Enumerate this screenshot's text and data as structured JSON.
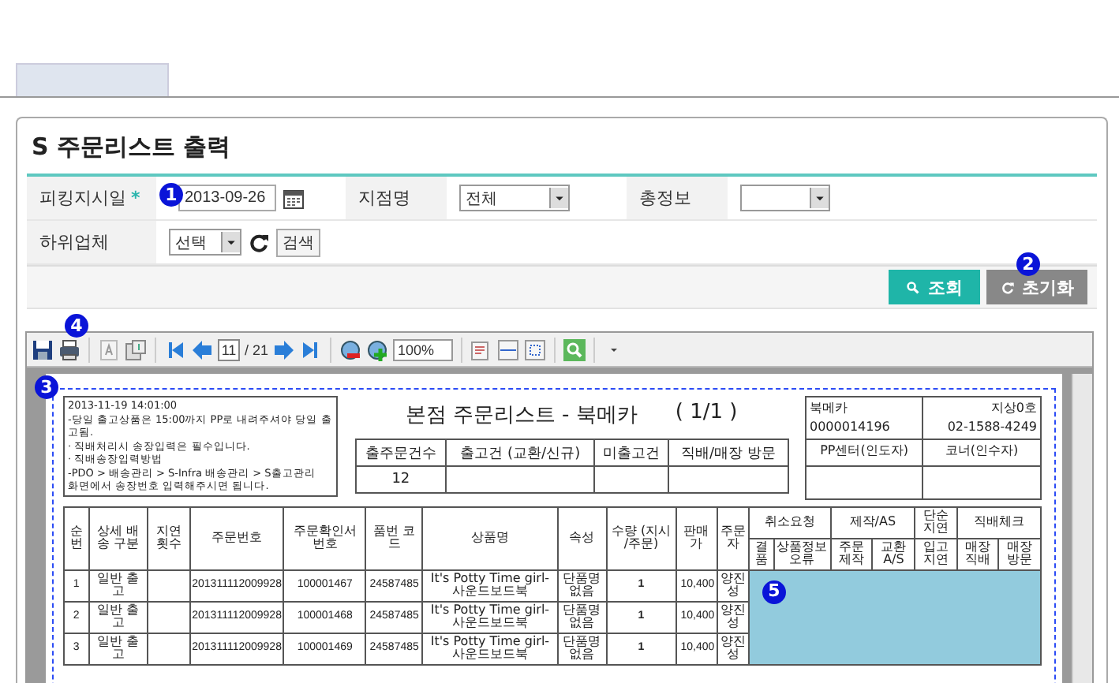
{
  "page": {
    "title": "S 주문리스트 출력"
  },
  "form": {
    "marker": "1",
    "rows": [
      {
        "fields": [
          {
            "kind": "date",
            "label": "피킹지시일",
            "required_mark": "*",
            "value": "2013-09-26"
          },
          {
            "kind": "select",
            "label": "지점명",
            "value": "전체"
          },
          {
            "kind": "select",
            "label": "총정보"
          }
        ]
      },
      {
        "fields": [
          {
            "kind": "vendor",
            "label": "하위업체",
            "value": "선택",
            "button": "검색"
          }
        ]
      }
    ]
  },
  "actions": {
    "marker": "2",
    "buttons": [
      {
        "kind": "search",
        "label": "조회"
      },
      {
        "kind": "reset",
        "label": "초기화"
      }
    ]
  },
  "viewer": {
    "marker": "4",
    "toolbar": {
      "page": "11",
      "page_total": "/ 21",
      "zoom": "100%"
    },
    "report": {
      "marker": "3",
      "note": [
        "2013-11-19 14:01:00",
        "-당일 출고상품은 15:00까지 PP로 내려주셔야 당일 출고됨.",
        "· 직배처리시 송장입력은 필수입니다.",
        "· 직배송장입력방법",
        "-PDO > 배송관리 > S-Infra 배송관리 > S출고관리",
        "화면에서 송장번호 입력해주시면 됩니다."
      ],
      "title": "본점 주문리스트 - 북메카",
      "page": "( 1/1 )",
      "summary": {
        "columns": [
          "출주문건수",
          "출고건 (교환/신규)",
          "미출고건",
          "직배/매장 방문"
        ],
        "values": [
          "12"
        ]
      },
      "info": {
        "store": "북메카",
        "store_code": "0000014196",
        "branch": "지상0호",
        "phone": "02-1588-4249",
        "handover": "PP센터(인도자)",
        "receiver": "코너(인수자)"
      },
      "columns": [
        {
          "label": "순번"
        },
        {
          "label": "상세 배송 구분"
        },
        {
          "label": "지연 횟수"
        },
        {
          "label": "주문번호"
        },
        {
          "label": "주문확인서 번호"
        },
        {
          "label": "품번 코드"
        },
        {
          "label": "상품명"
        },
        {
          "label": "속성"
        },
        {
          "label": "수량 (지시 /주문)",
          "kind": "bold"
        },
        {
          "label": "판매가",
          "kind": "amount"
        },
        {
          "label": "주문자"
        },
        {
          "label": "취소요청",
          "children": [
            "결품",
            "상품정보 오류"
          ]
        },
        {
          "label": "제작/AS",
          "children": [
            "주문 제작",
            "교환 A/S"
          ]
        },
        {
          "label": "단순 지연",
          "children": [
            "입고 지연"
          ]
        },
        {
          "label": "직배체크",
          "children": [
            "매장 직배",
            "매장 방문"
          ]
        }
      ],
      "rows": [
        {
          "cells": [
            "1",
            "일반 출고",
            null,
            "201311112009928",
            "100001467",
            "24587485",
            "It's Potty Time girl- 사운드보드북",
            "단품명 없음",
            "1",
            "10,400",
            "양진성"
          ]
        },
        {
          "cells": [
            "2",
            "일반 출고",
            null,
            "201311112009928",
            "100001468",
            "24587485",
            "It's Potty Time girl- 사운드보드북",
            "단품명 없음",
            "1",
            "10,400",
            "양진성"
          ]
        },
        {
          "cells": [
            "3",
            "일반 출고",
            null,
            "201311112009928",
            "100001469",
            "24587485",
            "It's Potty Time girl- 사운드보드북",
            "단품명 없음",
            "1",
            "10,400",
            "양진성"
          ]
        }
      ],
      "highlight_marker": "5"
    }
  }
}
